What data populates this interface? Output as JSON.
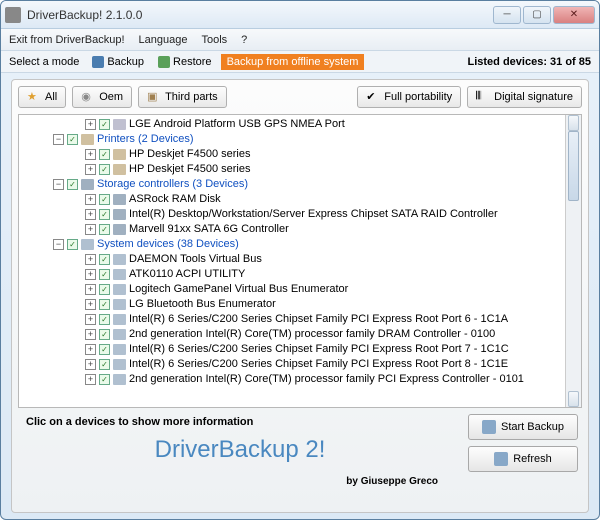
{
  "window": {
    "title": "DriverBackup! 2.1.0.0"
  },
  "menu": {
    "exit": "Exit from DriverBackup!",
    "language": "Language",
    "tools": "Tools",
    "help": "?"
  },
  "modebar": {
    "label": "Select a mode",
    "backup": "Backup",
    "restore": "Restore",
    "offline": "Backup from offline system",
    "listed": "Listed devices: 31 of 85"
  },
  "filters": {
    "all": "All",
    "oem": "Oem",
    "third": "Third parts",
    "portability": "Full portability",
    "signature": "Digital signature"
  },
  "tree": [
    {
      "depth": 3,
      "exp": "+",
      "cat": false,
      "text": "LGE Android Platform USB GPS NMEA Port",
      "icon": ""
    },
    {
      "depth": 1,
      "exp": "−",
      "cat": true,
      "text": "Printers   (2 Devices)",
      "icon": "printer"
    },
    {
      "depth": 3,
      "exp": "+",
      "cat": false,
      "text": "HP Deskjet F4500 series",
      "icon": "printer"
    },
    {
      "depth": 3,
      "exp": "+",
      "cat": false,
      "text": "HP Deskjet F4500 series",
      "icon": "printer"
    },
    {
      "depth": 1,
      "exp": "−",
      "cat": true,
      "text": "Storage controllers   (3 Devices)",
      "icon": "storage"
    },
    {
      "depth": 3,
      "exp": "+",
      "cat": false,
      "text": "ASRock RAM Disk",
      "icon": "storage"
    },
    {
      "depth": 3,
      "exp": "+",
      "cat": false,
      "text": "Intel(R) Desktop/Workstation/Server Express Chipset SATA RAID Controller",
      "icon": "storage"
    },
    {
      "depth": 3,
      "exp": "+",
      "cat": false,
      "text": "Marvell 91xx SATA 6G Controller",
      "icon": "storage"
    },
    {
      "depth": 1,
      "exp": "−",
      "cat": true,
      "text": "System devices   (38 Devices)",
      "icon": "system"
    },
    {
      "depth": 3,
      "exp": "+",
      "cat": false,
      "text": "DAEMON Tools Virtual Bus",
      "icon": "system"
    },
    {
      "depth": 3,
      "exp": "+",
      "cat": false,
      "text": "ATK0110 ACPI UTILITY",
      "icon": "system"
    },
    {
      "depth": 3,
      "exp": "+",
      "cat": false,
      "text": "Logitech GamePanel Virtual Bus Enumerator",
      "icon": "system"
    },
    {
      "depth": 3,
      "exp": "+",
      "cat": false,
      "text": "LG Bluetooth Bus Enumerator",
      "icon": "system"
    },
    {
      "depth": 3,
      "exp": "+",
      "cat": false,
      "text": "Intel(R) 6 Series/C200 Series Chipset Family PCI Express Root Port 6 - 1C1A",
      "icon": "system"
    },
    {
      "depth": 3,
      "exp": "+",
      "cat": false,
      "text": "2nd generation Intel(R) Core(TM) processor family DRAM Controller - 0100",
      "icon": "system"
    },
    {
      "depth": 3,
      "exp": "+",
      "cat": false,
      "text": "Intel(R) 6 Series/C200 Series Chipset Family PCI Express Root Port 7 - 1C1C",
      "icon": "system"
    },
    {
      "depth": 3,
      "exp": "+",
      "cat": false,
      "text": "Intel(R) 6 Series/C200 Series Chipset Family PCI Express Root Port 8 - 1C1E",
      "icon": "system"
    },
    {
      "depth": 3,
      "exp": "+",
      "cat": false,
      "text": "2nd generation Intel(R) Core(TM) processor family PCI Express Controller - 0101",
      "icon": "system"
    }
  ],
  "footer": {
    "hint": "Clic on a devices to show more information",
    "bigtitle": "DriverBackup 2!",
    "author": "by Giuseppe Greco",
    "start": "Start Backup",
    "refresh": "Refresh"
  }
}
